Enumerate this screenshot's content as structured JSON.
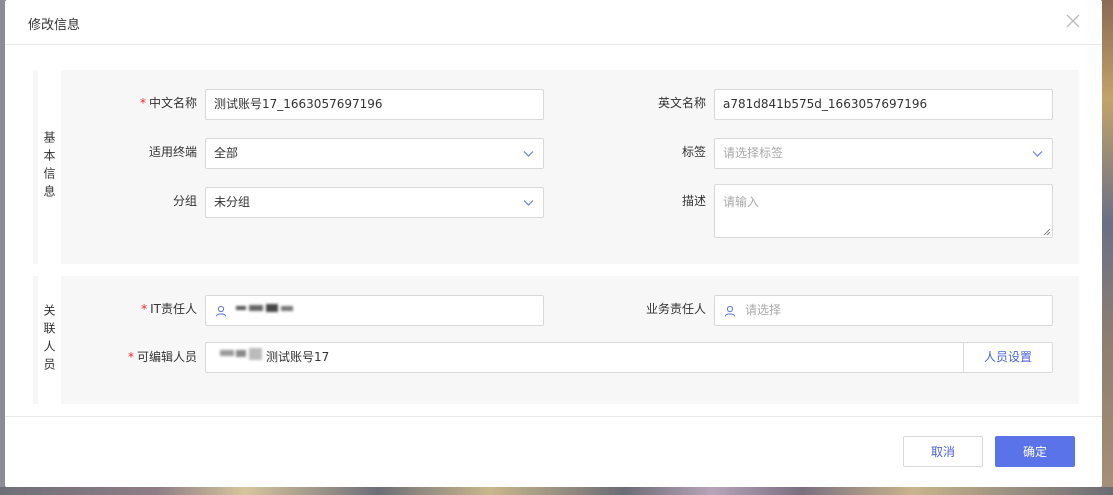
{
  "dialog": {
    "title": "修改信息"
  },
  "basic": {
    "section_label": "基本信息",
    "cn_name": {
      "label": "中文名称",
      "required": true,
      "value": "测试账号17_1663057697196"
    },
    "en_name": {
      "label": "英文名称",
      "value": "a781d841b575d_1663057697196"
    },
    "terminal": {
      "label": "适用终端",
      "value": "全部"
    },
    "tags": {
      "label": "标签",
      "placeholder": "请选择标签"
    },
    "group": {
      "label": "分组",
      "value": "未分组"
    },
    "desc": {
      "label": "描述",
      "placeholder": "请输入"
    }
  },
  "related": {
    "section_label": "关联人员",
    "it_owner": {
      "label": "IT责任人",
      "required": true
    },
    "biz_owner": {
      "label": "业务责任人",
      "placeholder": "请选择"
    },
    "editors": {
      "label": "可编辑人员",
      "required": true,
      "value_suffix": "测试账号17",
      "button_label": "人员设置"
    }
  },
  "footer": {
    "cancel_label": "取消",
    "ok_label": "确定"
  },
  "colors": {
    "accent": "#5b73e8",
    "link": "#4a63d8",
    "required": "#f5222d",
    "section_bg": "#f7f7f7"
  },
  "icons": {
    "close": "close-icon",
    "chevron": "chevron-down-icon",
    "user": "user-icon",
    "resize": "resize-grip-icon"
  }
}
